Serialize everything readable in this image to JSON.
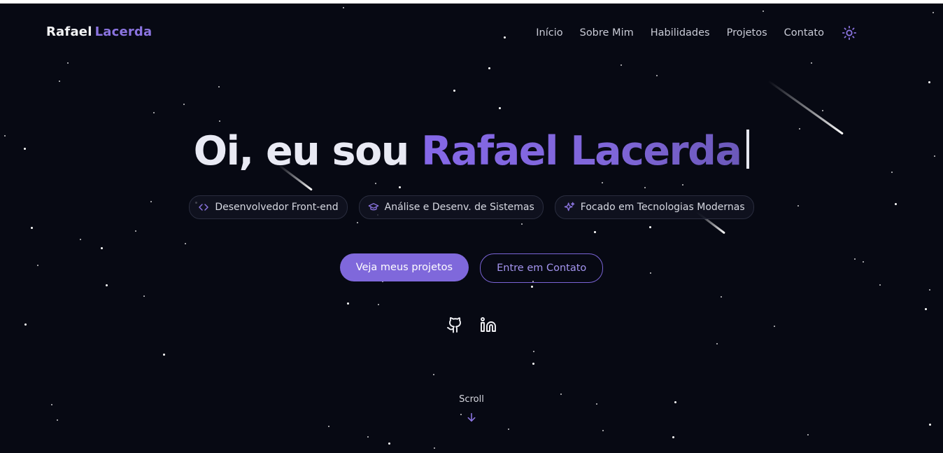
{
  "brand": {
    "first": "Rafael",
    "second": "Lacerda",
    "accent_color": "#8b74e0"
  },
  "nav": {
    "items": [
      "Início",
      "Sobre Mim",
      "Habilidades",
      "Projetos",
      "Contato"
    ],
    "theme_toggle_icon": "sun-icon"
  },
  "hero": {
    "greeting": "Oi, eu sou",
    "name": "Rafael Lacerda",
    "tags": [
      {
        "icon": "code-icon",
        "label": "Desenvolvedor Front-end"
      },
      {
        "icon": "graduation-cap-icon",
        "label": "Análise e Desenv. de Sistemas"
      },
      {
        "icon": "sparkles-icon",
        "label": "Focado em Tecnologias Modernas"
      }
    ],
    "primary_button": "Veja meus projetos",
    "secondary_button": "Entre em Contato",
    "socials": [
      "github-icon",
      "linkedin-icon"
    ],
    "scroll_label": "Scroll",
    "scroll_icon": "arrow-down-icon"
  },
  "colors": {
    "background": "#070913",
    "accent": "#7f68db",
    "text": "#e9eaf4"
  }
}
